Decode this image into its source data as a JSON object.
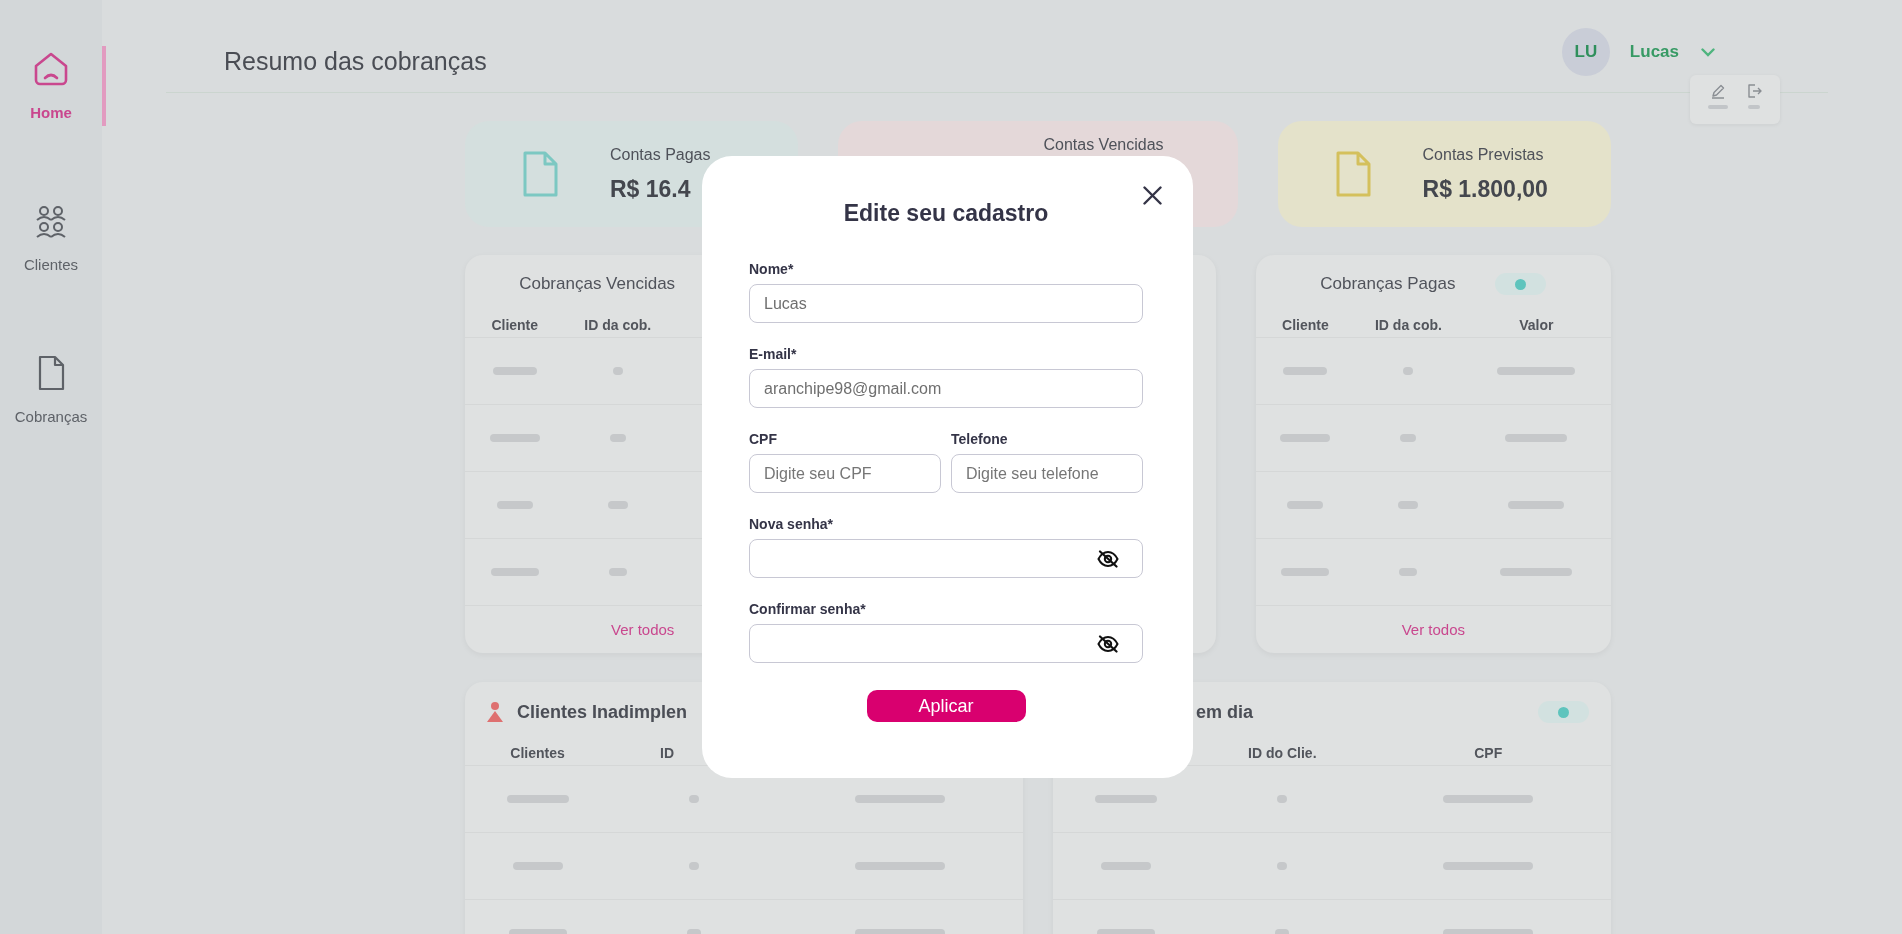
{
  "sidebar": {
    "items": [
      {
        "kind": "home",
        "label": "Home",
        "selected": true
      },
      {
        "kind": "clients",
        "label": "Clientes",
        "selected": false
      },
      {
        "kind": "charges",
        "label": "Cobranças",
        "selected": false
      }
    ]
  },
  "header": {
    "title": "Resumo das cobranças",
    "user": {
      "initials": "LU",
      "name": "Lucas"
    }
  },
  "summary_cards": [
    {
      "kind": "paid",
      "title": "Contas Pagas",
      "value": "R$ 16.4"
    },
    {
      "kind": "overdue",
      "title": "Contas Vencidas"
    },
    {
      "kind": "expected",
      "title": "Contas Previstas",
      "value": "R$ 1.800,00"
    }
  ],
  "charge_tables": [
    {
      "kind": "overdue",
      "title": "Cobranças Vencidas",
      "columns": [
        "Cliente",
        "ID da cob."
      ],
      "link": "Ver todos"
    },
    {
      "kind": "paid",
      "title": "Cobranças Pagas",
      "columns": [
        "Cliente",
        "ID da cob.",
        "Valor"
      ],
      "link": "Ver todos"
    }
  ],
  "client_tables": [
    {
      "kind": "defaulting",
      "title": "Clientes Inadimplen",
      "columns": [
        "Clientes",
        "ID"
      ]
    },
    {
      "kind": "current",
      "title": "em dia",
      "columns": [
        "ID do Clie.",
        "CPF"
      ]
    }
  ],
  "modal": {
    "title": "Edite seu cadastro",
    "fields": [
      {
        "kind": "text",
        "label": "Nome*",
        "value": "Lucas"
      },
      {
        "kind": "text",
        "label": "E-mail*",
        "value": "aranchipe98@gmail.com"
      },
      {
        "kind": "half",
        "label": "CPF",
        "placeholder": "Digite seu CPF"
      },
      {
        "kind": "half",
        "label": "Telefone",
        "placeholder": "Digite seu telefone"
      },
      {
        "kind": "password",
        "label": "Nova senha*"
      },
      {
        "kind": "password",
        "label": "Confirmar senha*"
      }
    ],
    "submit": "Aplicar"
  }
}
